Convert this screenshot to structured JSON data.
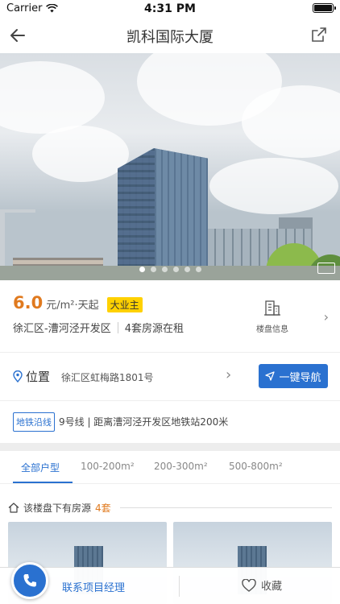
{
  "status_bar": {
    "carrier": "Carrier",
    "time": "4:31 PM"
  },
  "nav": {
    "title": "凯科国际大厦"
  },
  "hero": {
    "image_count": 6,
    "active_index": 0
  },
  "price": {
    "value": "6.0",
    "unit": "元/m²·天起",
    "tag": "大业主"
  },
  "location": {
    "district": "徐汇区-漕河泾开发区",
    "listings_text": "4套房源在租",
    "info_label": "楼盘信息"
  },
  "position": {
    "label": "位置",
    "address": "徐汇区虹梅路1801号",
    "nav_button": "一键导航"
  },
  "metro": {
    "tag": "地铁沿线",
    "text": "9号线 | 距离漕河泾开发区地铁站200米"
  },
  "tabs": [
    {
      "label": "全部户型",
      "active": true
    },
    {
      "label": "100-200m²",
      "active": false
    },
    {
      "label": "200-300m²",
      "active": false
    },
    {
      "label": "500-800m²",
      "active": false
    }
  ],
  "listing": {
    "header": "该楼盘下有房源",
    "count": "4套"
  },
  "bottom_bar": {
    "contact_label": "联系项目经理",
    "favorite_label": "收藏"
  },
  "colors": {
    "accent": "#2a71d0",
    "price": "#e07a1f",
    "tag_bg": "#ffd100"
  }
}
